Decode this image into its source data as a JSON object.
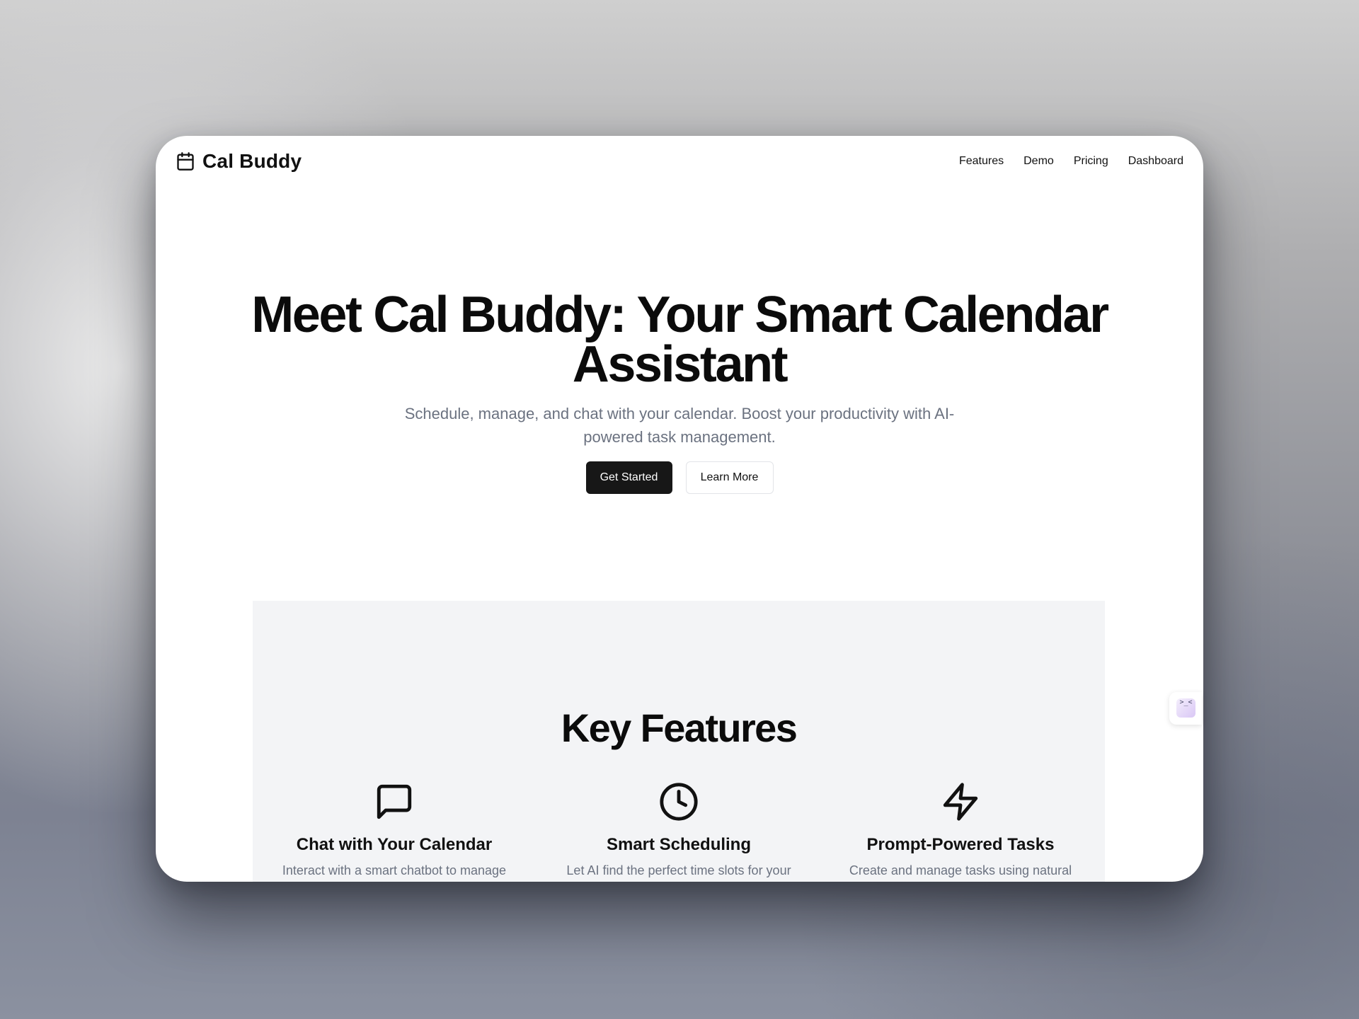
{
  "app": {
    "brand_name": "Cal Buddy",
    "brand_icon": "calendar-icon"
  },
  "nav": {
    "links": [
      "Features",
      "Demo",
      "Pricing",
      "Dashboard"
    ]
  },
  "hero": {
    "title": "Meet Cal Buddy: Your Smart Calendar Assistant",
    "subtitle": "Schedule, manage, and chat with your calendar. Boost your productivity with AI-powered task management.",
    "primary_button": "Get Started",
    "secondary_button": "Learn More"
  },
  "features": {
    "heading": "Key Features",
    "items": [
      {
        "icon": "message-square-icon",
        "title": "Chat with Your Calendar",
        "description": "Interact with a smart chatbot to manage"
      },
      {
        "icon": "clock-icon",
        "title": "Smart Scheduling",
        "description": "Let AI find the perfect time slots for your"
      },
      {
        "icon": "zap-icon",
        "title": "Prompt-Powered Tasks",
        "description": "Create and manage tasks using natural"
      }
    ]
  },
  "widget": {
    "icon": "terminal-icon",
    "glyph": ">_<"
  },
  "colors": {
    "primary_button": "#171717",
    "muted_text": "#6b7280",
    "features_background": "#f3f4f6",
    "heading_text": "#0b0b0b"
  }
}
